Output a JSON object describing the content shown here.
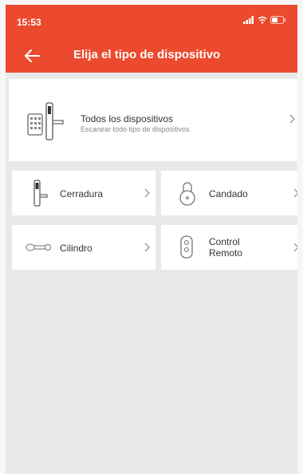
{
  "status_bar": {
    "time": "15:53"
  },
  "nav": {
    "title": "Elija el tipo de dispositivo"
  },
  "all_devices": {
    "title": "Todos los dispositivos",
    "subtitle": "Escanear todo tipo de dispositivos"
  },
  "device_types": [
    {
      "label": "Cerradura",
      "icon": "door-lock-icon"
    },
    {
      "label": "Candado",
      "icon": "padlock-icon"
    },
    {
      "label": "Cilindro",
      "icon": "cylinder-key-icon"
    },
    {
      "label": "Control Remoto",
      "icon": "remote-control-icon"
    }
  ],
  "colors": {
    "accent": "#ec4a2f",
    "background": "#e9e9ea",
    "card": "#ffffff"
  }
}
